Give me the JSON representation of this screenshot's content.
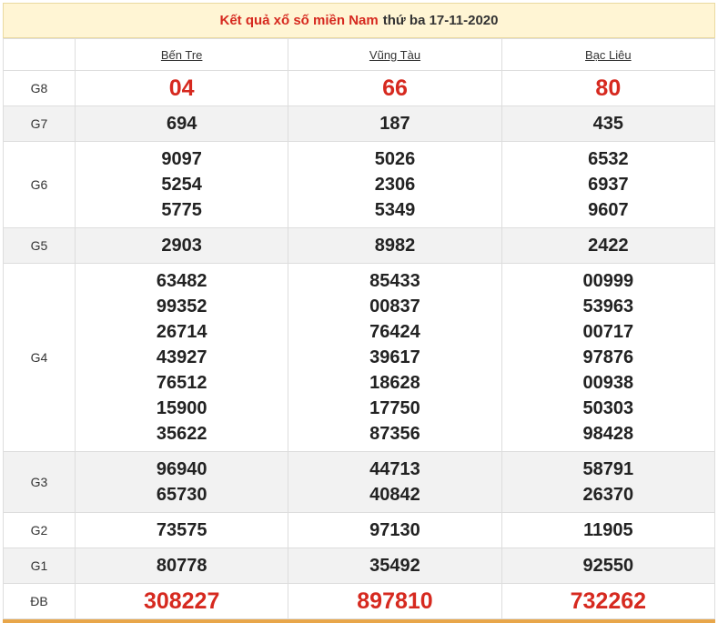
{
  "header": {
    "title_red": "Kết quả xổ số miền Nam",
    "title_date": "thứ ba 17-11-2020"
  },
  "provinces": [
    "Bến Tre",
    "Vũng Tàu",
    "Bạc Liêu"
  ],
  "rows": [
    {
      "label": "G8",
      "values": [
        [
          "04"
        ],
        [
          "66"
        ],
        [
          "80"
        ]
      ]
    },
    {
      "label": "G7",
      "values": [
        [
          "694"
        ],
        [
          "187"
        ],
        [
          "435"
        ]
      ]
    },
    {
      "label": "G6",
      "values": [
        [
          "9097",
          "5254",
          "5775"
        ],
        [
          "5026",
          "2306",
          "5349"
        ],
        [
          "6532",
          "6937",
          "9607"
        ]
      ]
    },
    {
      "label": "G5",
      "values": [
        [
          "2903"
        ],
        [
          "8982"
        ],
        [
          "2422"
        ]
      ]
    },
    {
      "label": "G4",
      "values": [
        [
          "63482",
          "99352",
          "26714",
          "43927",
          "76512",
          "15900",
          "35622"
        ],
        [
          "85433",
          "00837",
          "76424",
          "39617",
          "18628",
          "17750",
          "87356"
        ],
        [
          "00999",
          "53963",
          "00717",
          "97876",
          "00938",
          "50303",
          "98428"
        ]
      ]
    },
    {
      "label": "G3",
      "values": [
        [
          "96940",
          "65730"
        ],
        [
          "44713",
          "40842"
        ],
        [
          "58791",
          "26370"
        ]
      ]
    },
    {
      "label": "G2",
      "values": [
        [
          "73575"
        ],
        [
          "97130"
        ],
        [
          "11905"
        ]
      ]
    },
    {
      "label": "G1",
      "values": [
        [
          "80778"
        ],
        [
          "35492"
        ],
        [
          "92550"
        ]
      ]
    },
    {
      "label": "ĐB",
      "values": [
        [
          "308227"
        ],
        [
          "897810"
        ],
        [
          "732262"
        ]
      ]
    }
  ],
  "colors": {
    "accent_red": "#d6291f",
    "header_bg": "#fff5d4",
    "alt_row": "#f2f2f2"
  }
}
